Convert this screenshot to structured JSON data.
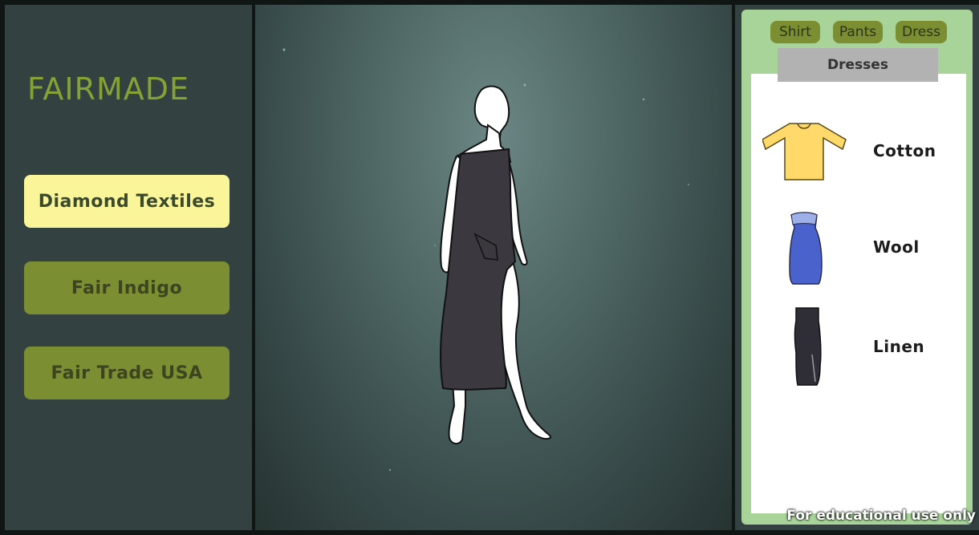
{
  "logo": {
    "text": "FAIRMADE"
  },
  "brands": [
    {
      "label": "Diamond Textiles",
      "selected": true
    },
    {
      "label": "Fair Indigo",
      "selected": false
    },
    {
      "label": "Fair Trade USA",
      "selected": false
    }
  ],
  "tabs": [
    {
      "label": "Shirt"
    },
    {
      "label": "Pants"
    },
    {
      "label": "Dress"
    }
  ],
  "category": {
    "title": "Dresses"
  },
  "fabrics": [
    {
      "label": "Cotton",
      "icon": "shirt-icon",
      "color": "#ffd96a"
    },
    {
      "label": "Wool",
      "icon": "strapless-dress-icon",
      "color": "#4a62cc"
    },
    {
      "label": "Linen",
      "icon": "long-dress-icon",
      "color": "#2f2d35"
    }
  ],
  "model": {
    "dress_color": "#3b3840"
  },
  "footer": {
    "note": "For educational use only"
  },
  "colors": {
    "panel": "#334140",
    "accent_green": "#7b8f32",
    "selected_yellow": "#fbf59a",
    "right_panel": "#a8d49a",
    "logo": "#86a236"
  }
}
